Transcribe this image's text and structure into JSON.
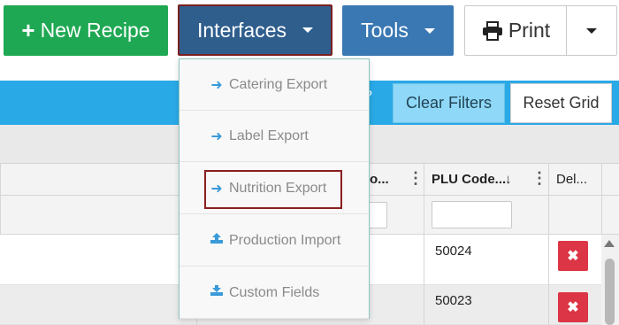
{
  "toolbar": {
    "new_recipe_label": "New Recipe",
    "interfaces_label": "Interfaces",
    "tools_label": "Tools",
    "print_label": "Print"
  },
  "filterbar": {
    "fragment": "?",
    "clear_filters_label": "Clear Filters",
    "reset_grid_label": "Reset Grid"
  },
  "grid": {
    "col_partial_header": "o...",
    "plu_header": "PLU Code...",
    "plu_sort_glyph": "↓",
    "delete_header": "Del...",
    "rows": [
      {
        "plu": "50024"
      },
      {
        "plu": "50023"
      }
    ]
  },
  "dropdown": {
    "items": [
      {
        "label": "Catering Export",
        "icon": "arrow-right-icon"
      },
      {
        "label": "Label Export",
        "icon": "arrow-right-icon"
      },
      {
        "label": "Nutrition Export",
        "icon": "arrow-right-icon"
      },
      {
        "label": "Production Import",
        "icon": "upload-icon"
      },
      {
        "label": "Custom Fields",
        "icon": "download-icon"
      }
    ]
  },
  "colors": {
    "new_recipe": "#1fa853",
    "interfaces": "#2f5e8d",
    "tools": "#3a78b3",
    "filterbar": "#2aa9e7",
    "delete": "#dc3545",
    "highlight_border": "#8a1f1f"
  }
}
